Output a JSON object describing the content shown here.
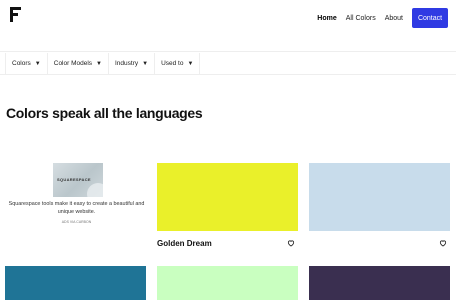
{
  "header": {
    "logo": "F",
    "nav": [
      "Home",
      "All Colors",
      "About"
    ],
    "contact": "Contact",
    "accent": "#2f3ae3"
  },
  "filters": [
    {
      "label": "Colors",
      "icon": "caret-down-icon"
    },
    {
      "label": "Color Models",
      "icon": "caret-down-icon"
    },
    {
      "label": "Industry",
      "icon": "caret-down-icon"
    },
    {
      "label": "Used to",
      "icon": "caret-down-icon"
    }
  ],
  "heading": "Colors speak all the languages",
  "ad": {
    "brand": "SQUARESPACE",
    "text": "Squarespace tools make it easy to create a beautiful and unique website.",
    "via": "ADS VIA CARBON"
  },
  "colors": [
    {
      "name": "Golden Dream",
      "hex": "#eaf02a"
    },
    {
      "name": "",
      "hex": "#c8dceb"
    },
    {
      "name": "",
      "hex": "#1f7496"
    },
    {
      "name": "",
      "hex": "#c9ffc0"
    },
    {
      "name": "",
      "hex": "#3a2f50"
    }
  ]
}
